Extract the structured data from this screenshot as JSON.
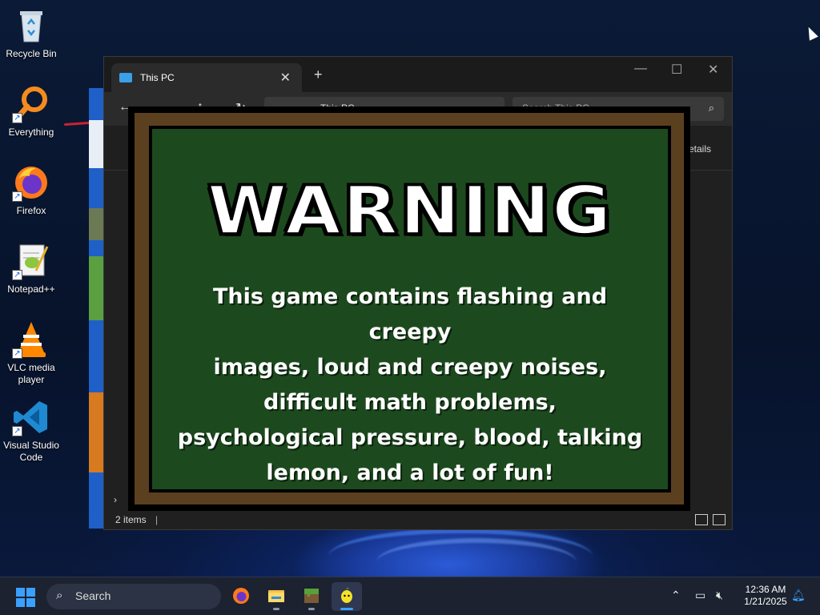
{
  "desktop": {
    "icons": [
      {
        "label": "Recycle Bin",
        "icon": "recycle-bin-icon"
      },
      {
        "label": "Everything",
        "icon": "everything-search-icon"
      },
      {
        "label": "Firefox",
        "icon": "firefox-icon"
      },
      {
        "label": "Notepad++",
        "icon": "notepad-plus-plus-icon"
      },
      {
        "label": "VLC media player",
        "icon": "vlc-icon"
      },
      {
        "label": "Visual Studio Code",
        "icon": "vscode-icon"
      }
    ]
  },
  "explorer": {
    "tab_title": "This PC",
    "new_tab": "+",
    "address": "This PC",
    "search_placeholder": "Search This PC",
    "details_label": "etails",
    "status": "2 items",
    "window_controls": {
      "minimize": "—",
      "maximize": "☐",
      "close": "✕"
    }
  },
  "warning": {
    "title": "WARNING",
    "lines": [
      "This game contains flashing and creepy",
      "images, loud and creepy noises,",
      "difficult math problems,",
      "psychological pressure, blood, talking",
      "lemon, and a lot of fun!"
    ]
  },
  "taskbar": {
    "search_label": "Search",
    "apps": [
      "firefox-icon",
      "file-explorer-icon",
      "minecraft-icon",
      "lemon-game-icon"
    ],
    "time": "12:36 AM",
    "date": "1/21/2025"
  },
  "colors": {
    "board_green": "#1c4a1e",
    "wood": "#5b4020",
    "accent": "#3aa0ff"
  }
}
